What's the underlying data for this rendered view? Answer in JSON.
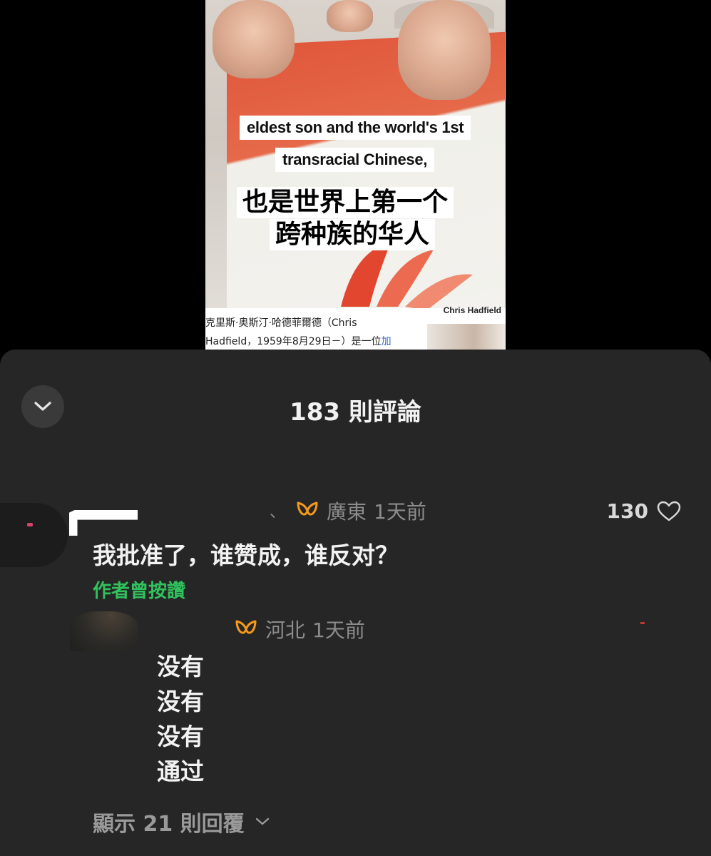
{
  "video": {
    "subtitle_en_line1": "eldest son and the world's 1st",
    "subtitle_en_line2": "transracial Chinese,",
    "subtitle_zh_line1": "也是世界上第一个",
    "subtitle_zh_line2": "跨种族的华人",
    "wiki_caption": "Chris Hadfield",
    "wiki_line1": "克里斯·奥斯汀·哈德菲爾德（Chris",
    "wiki_line2": "Hadfield，1959年8月29日－）是一位",
    "wiki_link": "加"
  },
  "sheet": {
    "title": "183 則評論"
  },
  "comments": [
    {
      "location": "廣東",
      "time": "1天前",
      "separator": "、",
      "likes": "130",
      "text": "我批准了，谁赞成，谁反对？",
      "badge": "作者曾按讚"
    },
    {
      "location": "河北",
      "time": "1天前",
      "lines": [
        "没有",
        "没有",
        "没有",
        "通过"
      ]
    }
  ],
  "replies": {
    "label": "顯示 21 則回覆"
  },
  "colors": {
    "sheet_bg": "#262626",
    "brand_orange": "#f59a1b",
    "author_green": "#31c25d",
    "meta_gray": "#8c8c8c"
  }
}
